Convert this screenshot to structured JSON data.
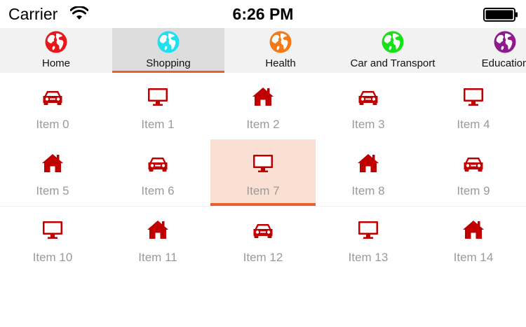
{
  "status_bar": {
    "carrier": "Carrier",
    "time": "6:26 PM",
    "wifi_icon": "wifi-icon",
    "battery_icon": "battery-icon"
  },
  "tabs": [
    {
      "label": "Home",
      "icon": "globe-icon",
      "color": "#e8171b",
      "selected": false
    },
    {
      "label": "Shopping",
      "icon": "globe-icon",
      "color": "#1ee0ee",
      "selected": true
    },
    {
      "label": "Health",
      "icon": "globe-icon",
      "color": "#f47a16",
      "selected": false
    },
    {
      "label": "Car and Transport",
      "icon": "globe-icon",
      "color": "#16e016",
      "selected": false
    },
    {
      "label": "Education",
      "icon": "globe-icon",
      "color": "#8e1a8e",
      "selected": false
    }
  ],
  "accent_color": "#e8602c",
  "icon_color": "#c00000",
  "items": [
    {
      "label": "Item 0",
      "icon": "car-icon"
    },
    {
      "label": "Item 1",
      "icon": "monitor-icon"
    },
    {
      "label": "Item 2",
      "icon": "house-icon"
    },
    {
      "label": "Item 3",
      "icon": "car-icon"
    },
    {
      "label": "Item 4",
      "icon": "monitor-icon"
    },
    {
      "label": "Item 5",
      "icon": "house-icon"
    },
    {
      "label": "Item 6",
      "icon": "car-icon"
    },
    {
      "label": "Item 7",
      "icon": "monitor-icon",
      "selected": true
    },
    {
      "label": "Item 8",
      "icon": "house-icon"
    },
    {
      "label": "Item 9",
      "icon": "car-icon"
    },
    {
      "label": "Item 10",
      "icon": "monitor-icon"
    },
    {
      "label": "Item 11",
      "icon": "house-icon"
    },
    {
      "label": "Item 12",
      "icon": "car-icon"
    },
    {
      "label": "Item 13",
      "icon": "monitor-icon"
    },
    {
      "label": "Item 14",
      "icon": "house-icon"
    }
  ]
}
